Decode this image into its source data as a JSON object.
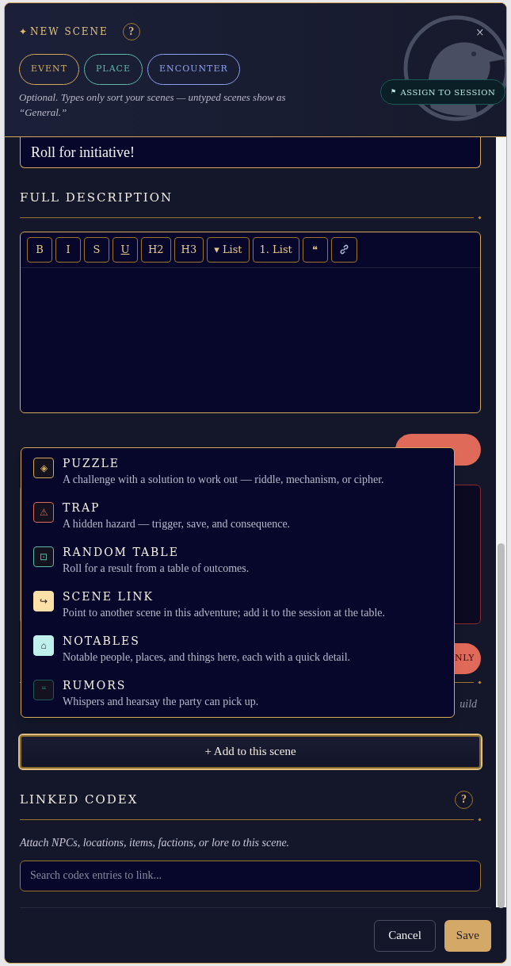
{
  "header": {
    "title_icon": "✦",
    "title": "NEW SCENE",
    "help": "?",
    "close": "×",
    "types": [
      {
        "label": "EVENT",
        "selected": false,
        "color": "#d4a95a"
      },
      {
        "label": "PLACE",
        "selected": false,
        "color": "#5fb8a8"
      },
      {
        "label": "ENCOUNTER",
        "selected": false,
        "color": "#8fa0f0"
      }
    ],
    "types_hint": "Optional. Types only sort your scenes — untyped scenes show as “General.”",
    "assign_button": {
      "icon": "⚑",
      "label": "ASSIGN TO SESSION"
    }
  },
  "name_value": "Roll for initiative!",
  "full_description": {
    "heading": "FULL DESCRIPTION",
    "toolbar": [
      {
        "label": "B",
        "kind": "text"
      },
      {
        "label": "I",
        "kind": "text"
      },
      {
        "label": "S",
        "kind": "text"
      },
      {
        "label": "U",
        "kind": "underline"
      },
      {
        "label": "H2",
        "kind": "text"
      },
      {
        "label": "H3",
        "kind": "text"
      },
      {
        "label": "▾ List",
        "kind": "text"
      },
      {
        "label": "1. List",
        "kind": "text"
      },
      {
        "label": "❝",
        "kind": "text"
      },
      {
        "kind": "link"
      }
    ]
  },
  "gm_notes": {
    "badge_tail": "NLY",
    "hint_tail": "uild"
  },
  "add_menu": [
    {
      "icon": "◈",
      "title": "PUZZLE",
      "description": "A challenge with a solution to work out — riddle, mechanism, or cipher.",
      "color": "#d4a95a",
      "filled": false
    },
    {
      "icon": "⚠",
      "title": "TRAP",
      "description": "A hidden hazard — trigger, save, and consequence.",
      "color": "#e06a5a",
      "filled": false
    },
    {
      "icon": "⊡",
      "title": "RANDOM TABLE",
      "description": "Roll for a result from a table of outcomes.",
      "color": "#5fb8a8",
      "filled": false
    },
    {
      "icon": "↪",
      "title": "SCENE LINK",
      "description": "Point to another scene in this adventure; add it to the session at the table.",
      "color": "#fde0a8",
      "filled": true
    },
    {
      "icon": "⌂",
      "title": "NOTABLES",
      "description": "Notable people, places, and things here, each with a quick detail.",
      "color": "#bff0ec",
      "filled": true
    },
    {
      "icon": "❝",
      "title": "RUMORS",
      "description": "Whispers and hearsay the party can pick up.",
      "color": "#1f5a5a",
      "filled": false
    }
  ],
  "add_button": "+ Add to this scene",
  "linked_codex": {
    "heading": "LINKED CODEX",
    "help": "?",
    "hint": "Attach NPCs, locations, items, factions, or lore to this scene.",
    "placeholder": "Search codex entries to link..."
  },
  "footer": {
    "cancel": "Cancel",
    "save": "Save"
  }
}
